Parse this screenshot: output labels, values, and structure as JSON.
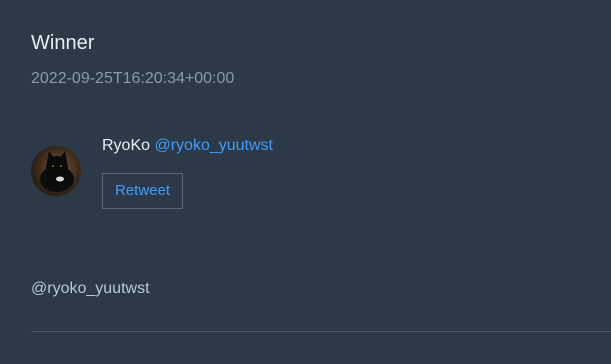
{
  "post": {
    "title": "Winner",
    "timestamp": "2022-09-25T16:20:34+00:00"
  },
  "user": {
    "name": "RyoKo",
    "handle": "@ryoko_yuutwst",
    "avatar_icon": "black-cat-avatar"
  },
  "actions": {
    "retweet_label": "Retweet"
  },
  "body": {
    "mention": "@ryoko_yuutwst"
  },
  "colors": {
    "background": "#2b3a46",
    "link": "#3f9bff",
    "muted": "#8a9aa8"
  }
}
